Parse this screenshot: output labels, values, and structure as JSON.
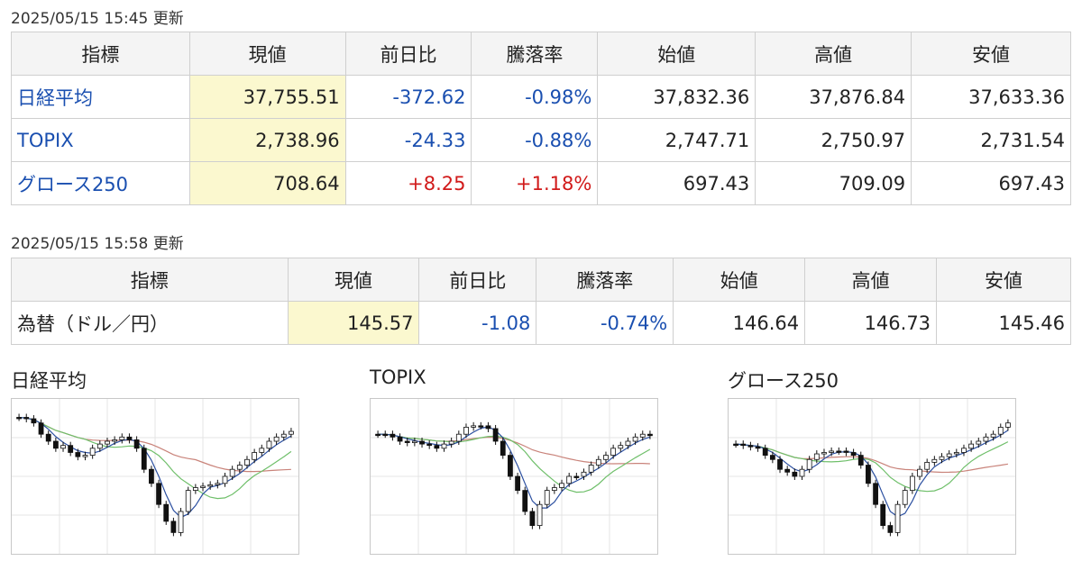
{
  "market": {
    "timestamp": "2025/05/15 15:45 更新",
    "headers": [
      "指標",
      "現値",
      "前日比",
      "騰落率",
      "始値",
      "高値",
      "安値"
    ],
    "rows": [
      {
        "name": "日経平均",
        "current": "37,755.51",
        "change": "-372.62",
        "rate": "-0.98%",
        "open": "37,832.36",
        "high": "37,876.84",
        "low": "37,633.36",
        "dir": "neg"
      },
      {
        "name": "TOPIX",
        "current": "2,738.96",
        "change": "-24.33",
        "rate": "-0.88%",
        "open": "2,747.71",
        "high": "2,750.97",
        "low": "2,731.54",
        "dir": "neg"
      },
      {
        "name": "グロース250",
        "current": "708.64",
        "change": "+8.25",
        "rate": "+1.18%",
        "open": "697.43",
        "high": "709.09",
        "low": "697.43",
        "dir": "pos"
      }
    ]
  },
  "fx": {
    "timestamp": "2025/05/15 15:58 更新",
    "headers": [
      "指標",
      "現値",
      "前日比",
      "騰落率",
      "始値",
      "高値",
      "安値"
    ],
    "rows": [
      {
        "name": "為替（ドル／円）",
        "current": "145.57",
        "change": "-1.08",
        "rate": "-0.74%",
        "open": "146.64",
        "high": "146.73",
        "low": "145.46",
        "dir": "neg"
      }
    ]
  },
  "charts": [
    {
      "title": "日経平均"
    },
    {
      "title": "TOPIX"
    },
    {
      "title": "グロース250"
    }
  ],
  "colors": {
    "link": "#1a4fb0",
    "negative": "#1a4fb0",
    "positive": "#d11a1a",
    "highlight": "#fbf8cf",
    "ma_short": "#2b4fa0",
    "ma_mid": "#6fbf6a",
    "ma_long": "#c9837a"
  },
  "chart_data": [
    {
      "type": "candlestick",
      "series": [
        {
          "values": [
            0.08,
            0.09,
            0.12,
            0.2,
            0.25,
            0.3,
            0.28,
            0.33,
            0.36,
            0.35,
            0.3,
            0.27,
            0.25,
            0.24,
            0.22,
            0.24,
            0.3,
            0.45,
            0.55,
            0.7,
            0.82,
            0.9,
            0.75,
            0.6,
            0.58,
            0.57,
            0.56,
            0.55,
            0.5,
            0.45,
            0.42,
            0.38,
            0.33,
            0.3,
            0.25,
            0.22,
            0.2,
            0.18
          ]
        }
      ]
    },
    {
      "type": "candlestick",
      "series": [
        {
          "values": [
            0.2,
            0.2,
            0.22,
            0.25,
            0.26,
            0.25,
            0.27,
            0.28,
            0.3,
            0.27,
            0.25,
            0.2,
            0.15,
            0.14,
            0.14,
            0.16,
            0.25,
            0.35,
            0.5,
            0.6,
            0.75,
            0.85,
            0.7,
            0.6,
            0.58,
            0.55,
            0.5,
            0.5,
            0.47,
            0.42,
            0.38,
            0.35,
            0.3,
            0.28,
            0.25,
            0.22,
            0.2,
            0.21
          ]
        }
      ]
    },
    {
      "type": "candlestick",
      "series": [
        {
          "values": [
            0.27,
            0.28,
            0.29,
            0.3,
            0.35,
            0.38,
            0.45,
            0.47,
            0.5,
            0.45,
            0.38,
            0.34,
            0.33,
            0.32,
            0.32,
            0.33,
            0.35,
            0.42,
            0.55,
            0.7,
            0.85,
            0.9,
            0.7,
            0.6,
            0.5,
            0.45,
            0.4,
            0.38,
            0.36,
            0.34,
            0.33,
            0.3,
            0.27,
            0.25,
            0.22,
            0.2,
            0.15,
            0.12
          ]
        }
      ]
    }
  ]
}
